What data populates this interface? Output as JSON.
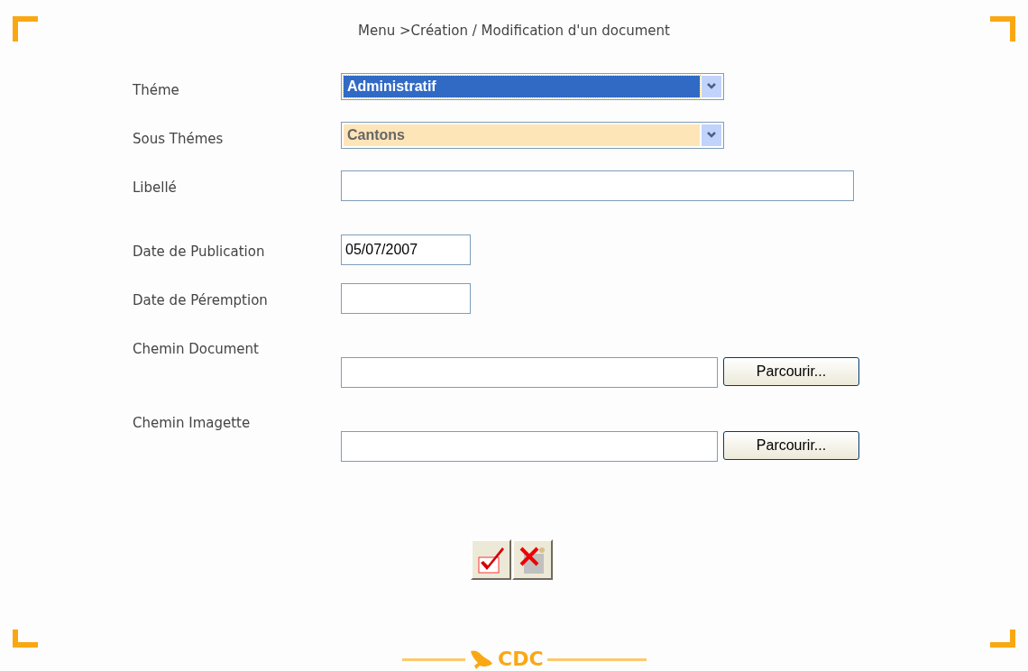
{
  "breadcrumb": "Menu >Création / Modification d'un document",
  "fields": [
    {
      "kind": "select",
      "label": "Théme",
      "value": "Administratif",
      "focused": true
    },
    {
      "kind": "select",
      "label": "Sous Thémes",
      "value": "Cantons",
      "focused": false
    },
    {
      "kind": "text",
      "label": "Libellé"
    },
    {
      "kind": "date",
      "label": "Date de Publication",
      "value": "05/07/2007"
    },
    {
      "kind": "date",
      "label": "Date de Péremption"
    },
    {
      "kind": "file",
      "label": "Chemin Document",
      "button": "Parcourir..."
    },
    {
      "kind": "file",
      "label": "Chemin Imagette",
      "button": "Parcourir..."
    }
  ],
  "footer": {
    "logo": "CDC"
  }
}
